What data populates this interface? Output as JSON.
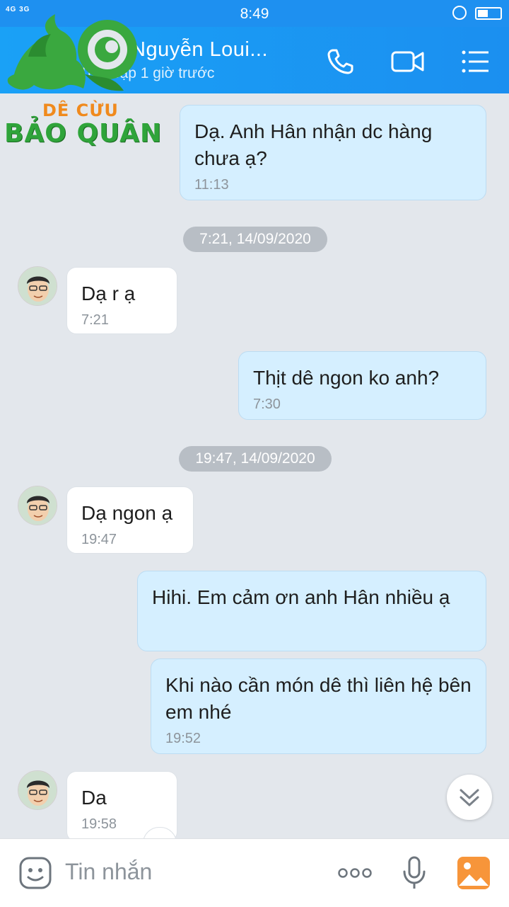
{
  "status": {
    "time": "8:49",
    "signal": "4G 3G"
  },
  "header": {
    "name": "Nguyễn  Loui...",
    "subtitle": "Truy cập 1 giờ trước"
  },
  "logo": {
    "line1": "DÊ CỪU",
    "line2": "BẢO QUÂN"
  },
  "messages": [
    {
      "dir": "out",
      "text": "Dạ.  Anh Hân nhận dc hàng chưa ạ?",
      "time": "11:13"
    },
    {
      "dir": "in",
      "text": "Dạ r ạ",
      "time": "7:21"
    },
    {
      "dir": "out",
      "text": "Thịt dê ngon ko anh?",
      "time": "7:30"
    },
    {
      "dir": "in",
      "text": "Dạ ngon ạ",
      "time": "19:47"
    },
    {
      "dir": "out",
      "text": "Hihi. Em cảm ơn anh Hân nhiều ạ",
      "time": ""
    },
    {
      "dir": "out",
      "text": "Khi nào cần món dê thì liên hệ bên em nhé",
      "time": "19:52"
    },
    {
      "dir": "in",
      "text": "Da",
      "time": "19:58"
    }
  ],
  "date_dividers": [
    "7:21, 14/09/2020",
    "19:47, 14/09/2020"
  ],
  "composer": {
    "placeholder": "Tin nhắn"
  },
  "colors": {
    "header": "#1b8ff0",
    "outgoing": "#d5efff",
    "incoming": "#ffffff",
    "background": "#e3e7ec"
  },
  "icons": {
    "header": [
      "phone-icon",
      "video-call-icon",
      "menu-list-icon"
    ],
    "composer": [
      "sticker-emoji-icon",
      "more-dots-icon",
      "microphone-icon",
      "image-gallery-icon"
    ]
  }
}
